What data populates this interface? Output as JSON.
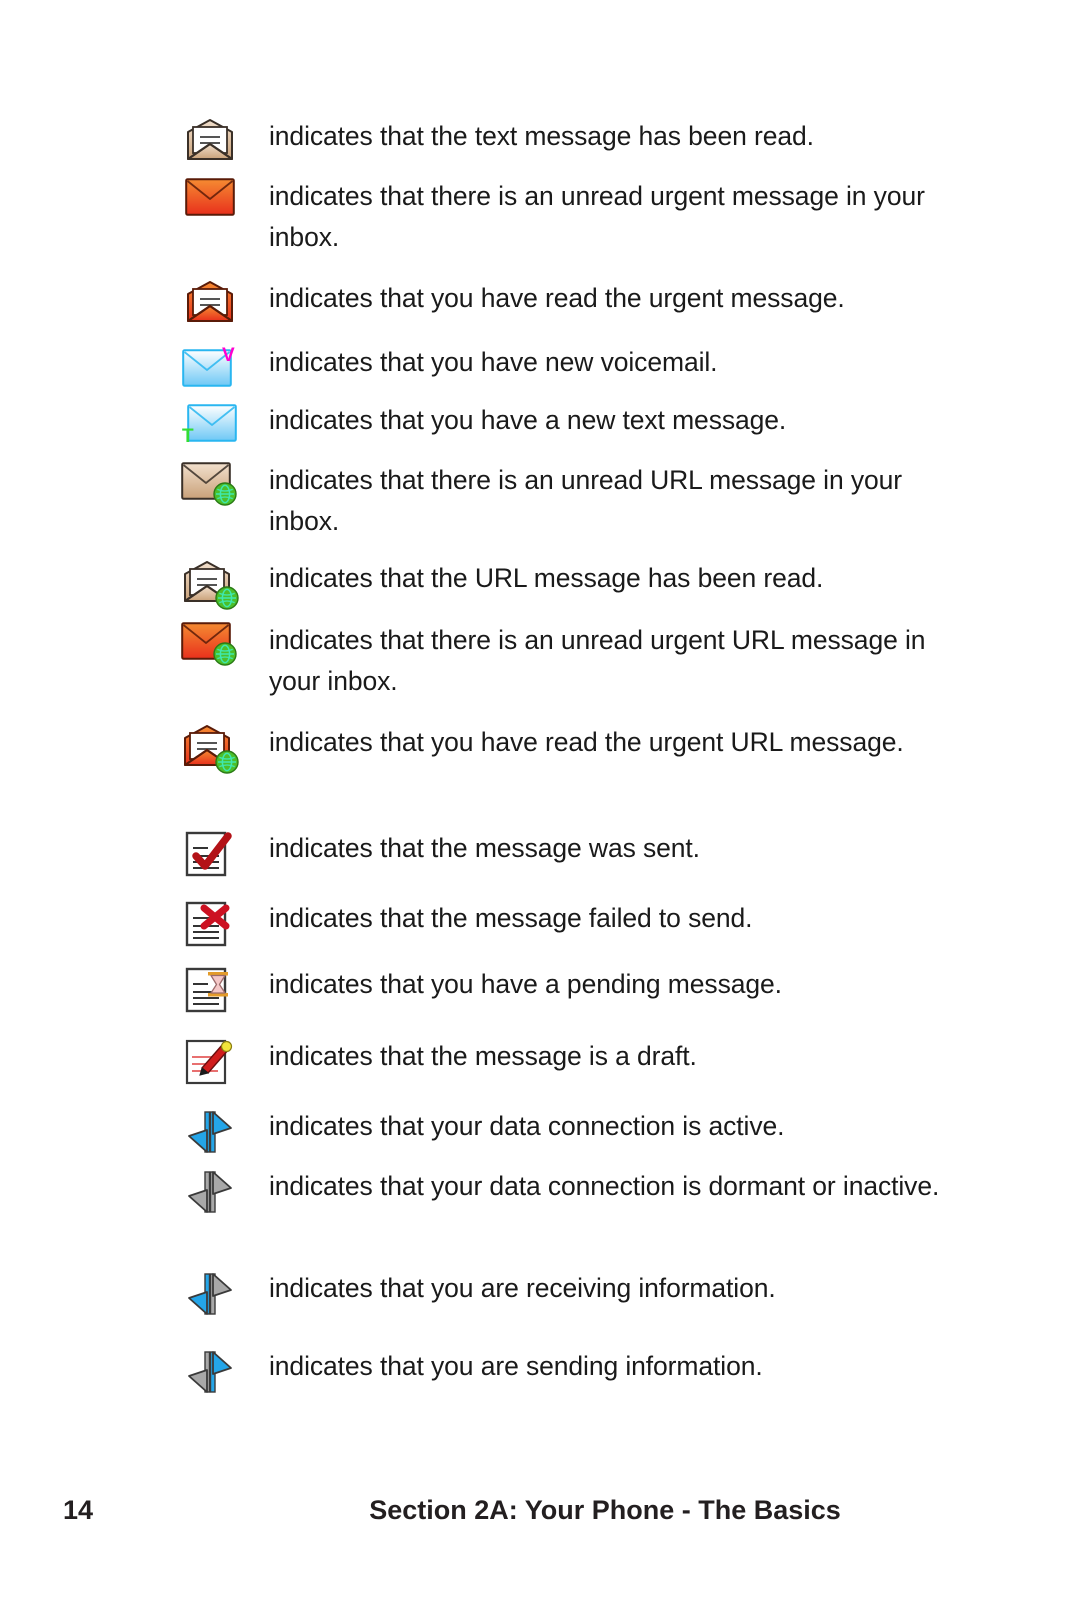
{
  "page": {
    "background": "#ffffff",
    "text_color": "#1a1a1a"
  },
  "colors": {
    "tan_light": "#f2e0cd",
    "tan_dark": "#c9a179",
    "urgent_light": "#f58b32",
    "urgent_dark": "#e8301c",
    "blue_light": "#e8f7ff",
    "blue_dark": "#6ec8f5",
    "blue_border": "#29b6f0",
    "voicemail_marker": "#ff00d0",
    "text_marker": "#33dd33",
    "url_badge_green": "#4cbf2a",
    "url_badge_glyph": "#3ee8b0",
    "doc_white": "#ffffff",
    "doc_border": "#3a3a3a",
    "check_red": "#b31217",
    "x_red": "#cc1122",
    "pencil_red": "#d01c1c",
    "pencil_tip_yellow": "#f2e53b",
    "hourglass_orange": "#e39b2a",
    "hourglass_pink": "#f4c7c7",
    "arrow_blue": "#24a5e8",
    "arrow_gray": "#a8a8a8",
    "arrow_outline": "#3a3a3a"
  },
  "list": [
    {
      "icon": "envelope-open-read-icon",
      "icon_kind": "env-open-tan",
      "text": "indicates that the text message has been read."
    },
    {
      "icon": "envelope-closed-urgent-unread-icon",
      "icon_kind": "env-closed-urgent",
      "text": "indicates that there is an unread urgent message in your inbox."
    },
    {
      "icon": "envelope-open-urgent-read-icon",
      "icon_kind": "env-open-urgent",
      "text": "indicates that you have read the urgent message."
    },
    {
      "icon": "envelope-voicemail-icon",
      "icon_kind": "env-closed-voicemail",
      "text": "indicates that you have new voicemail."
    },
    {
      "icon": "envelope-new-text-icon",
      "icon_kind": "env-closed-text",
      "text": "indicates that you have a new text message."
    },
    {
      "icon": "envelope-closed-url-unread-icon",
      "icon_kind": "env-closed-tan-url",
      "text": "indicates that there is an unread URL message in your inbox."
    },
    {
      "icon": "envelope-open-url-read-icon",
      "icon_kind": "env-open-tan-url",
      "text": "indicates that the URL message has been read."
    },
    {
      "icon": "envelope-closed-urgent-url-unread-icon",
      "icon_kind": "env-closed-urgent-url",
      "text": "indicates that there is an unread urgent URL message in your inbox."
    },
    {
      "icon": "envelope-open-urgent-url-read-icon",
      "icon_kind": "env-open-urgent-url",
      "text": "indicates that you have read the urgent URL message."
    },
    {
      "icon": "document-sent-check-icon",
      "icon_kind": "doc-check",
      "text": "indicates that the message was sent."
    },
    {
      "icon": "document-failed-x-icon",
      "icon_kind": "doc-x",
      "text": "indicates that the message failed to send."
    },
    {
      "icon": "document-pending-hourglass-icon",
      "icon_kind": "doc-hourglass",
      "text": "indicates that you have a pending message."
    },
    {
      "icon": "document-draft-pencil-icon",
      "icon_kind": "doc-pencil",
      "text": "indicates that the message is a draft."
    },
    {
      "icon": "data-connection-active-icon",
      "icon_kind": "arrows-blue-blue",
      "text": "indicates that your data connection is active."
    },
    {
      "icon": "data-connection-dormant-icon",
      "icon_kind": "arrows-gray-gray",
      "text": "indicates that your data connection is dormant or inactive."
    },
    {
      "icon": "data-receiving-icon",
      "icon_kind": "arrows-blue-gray",
      "text": "indicates that you are receiving information."
    },
    {
      "icon": "data-sending-icon",
      "icon_kind": "arrows-gray-blue",
      "text": "indicates that you are sending information."
    }
  ],
  "footer": {
    "page_number": "14",
    "section_title": "Section 2A: Your Phone - The Basics"
  }
}
